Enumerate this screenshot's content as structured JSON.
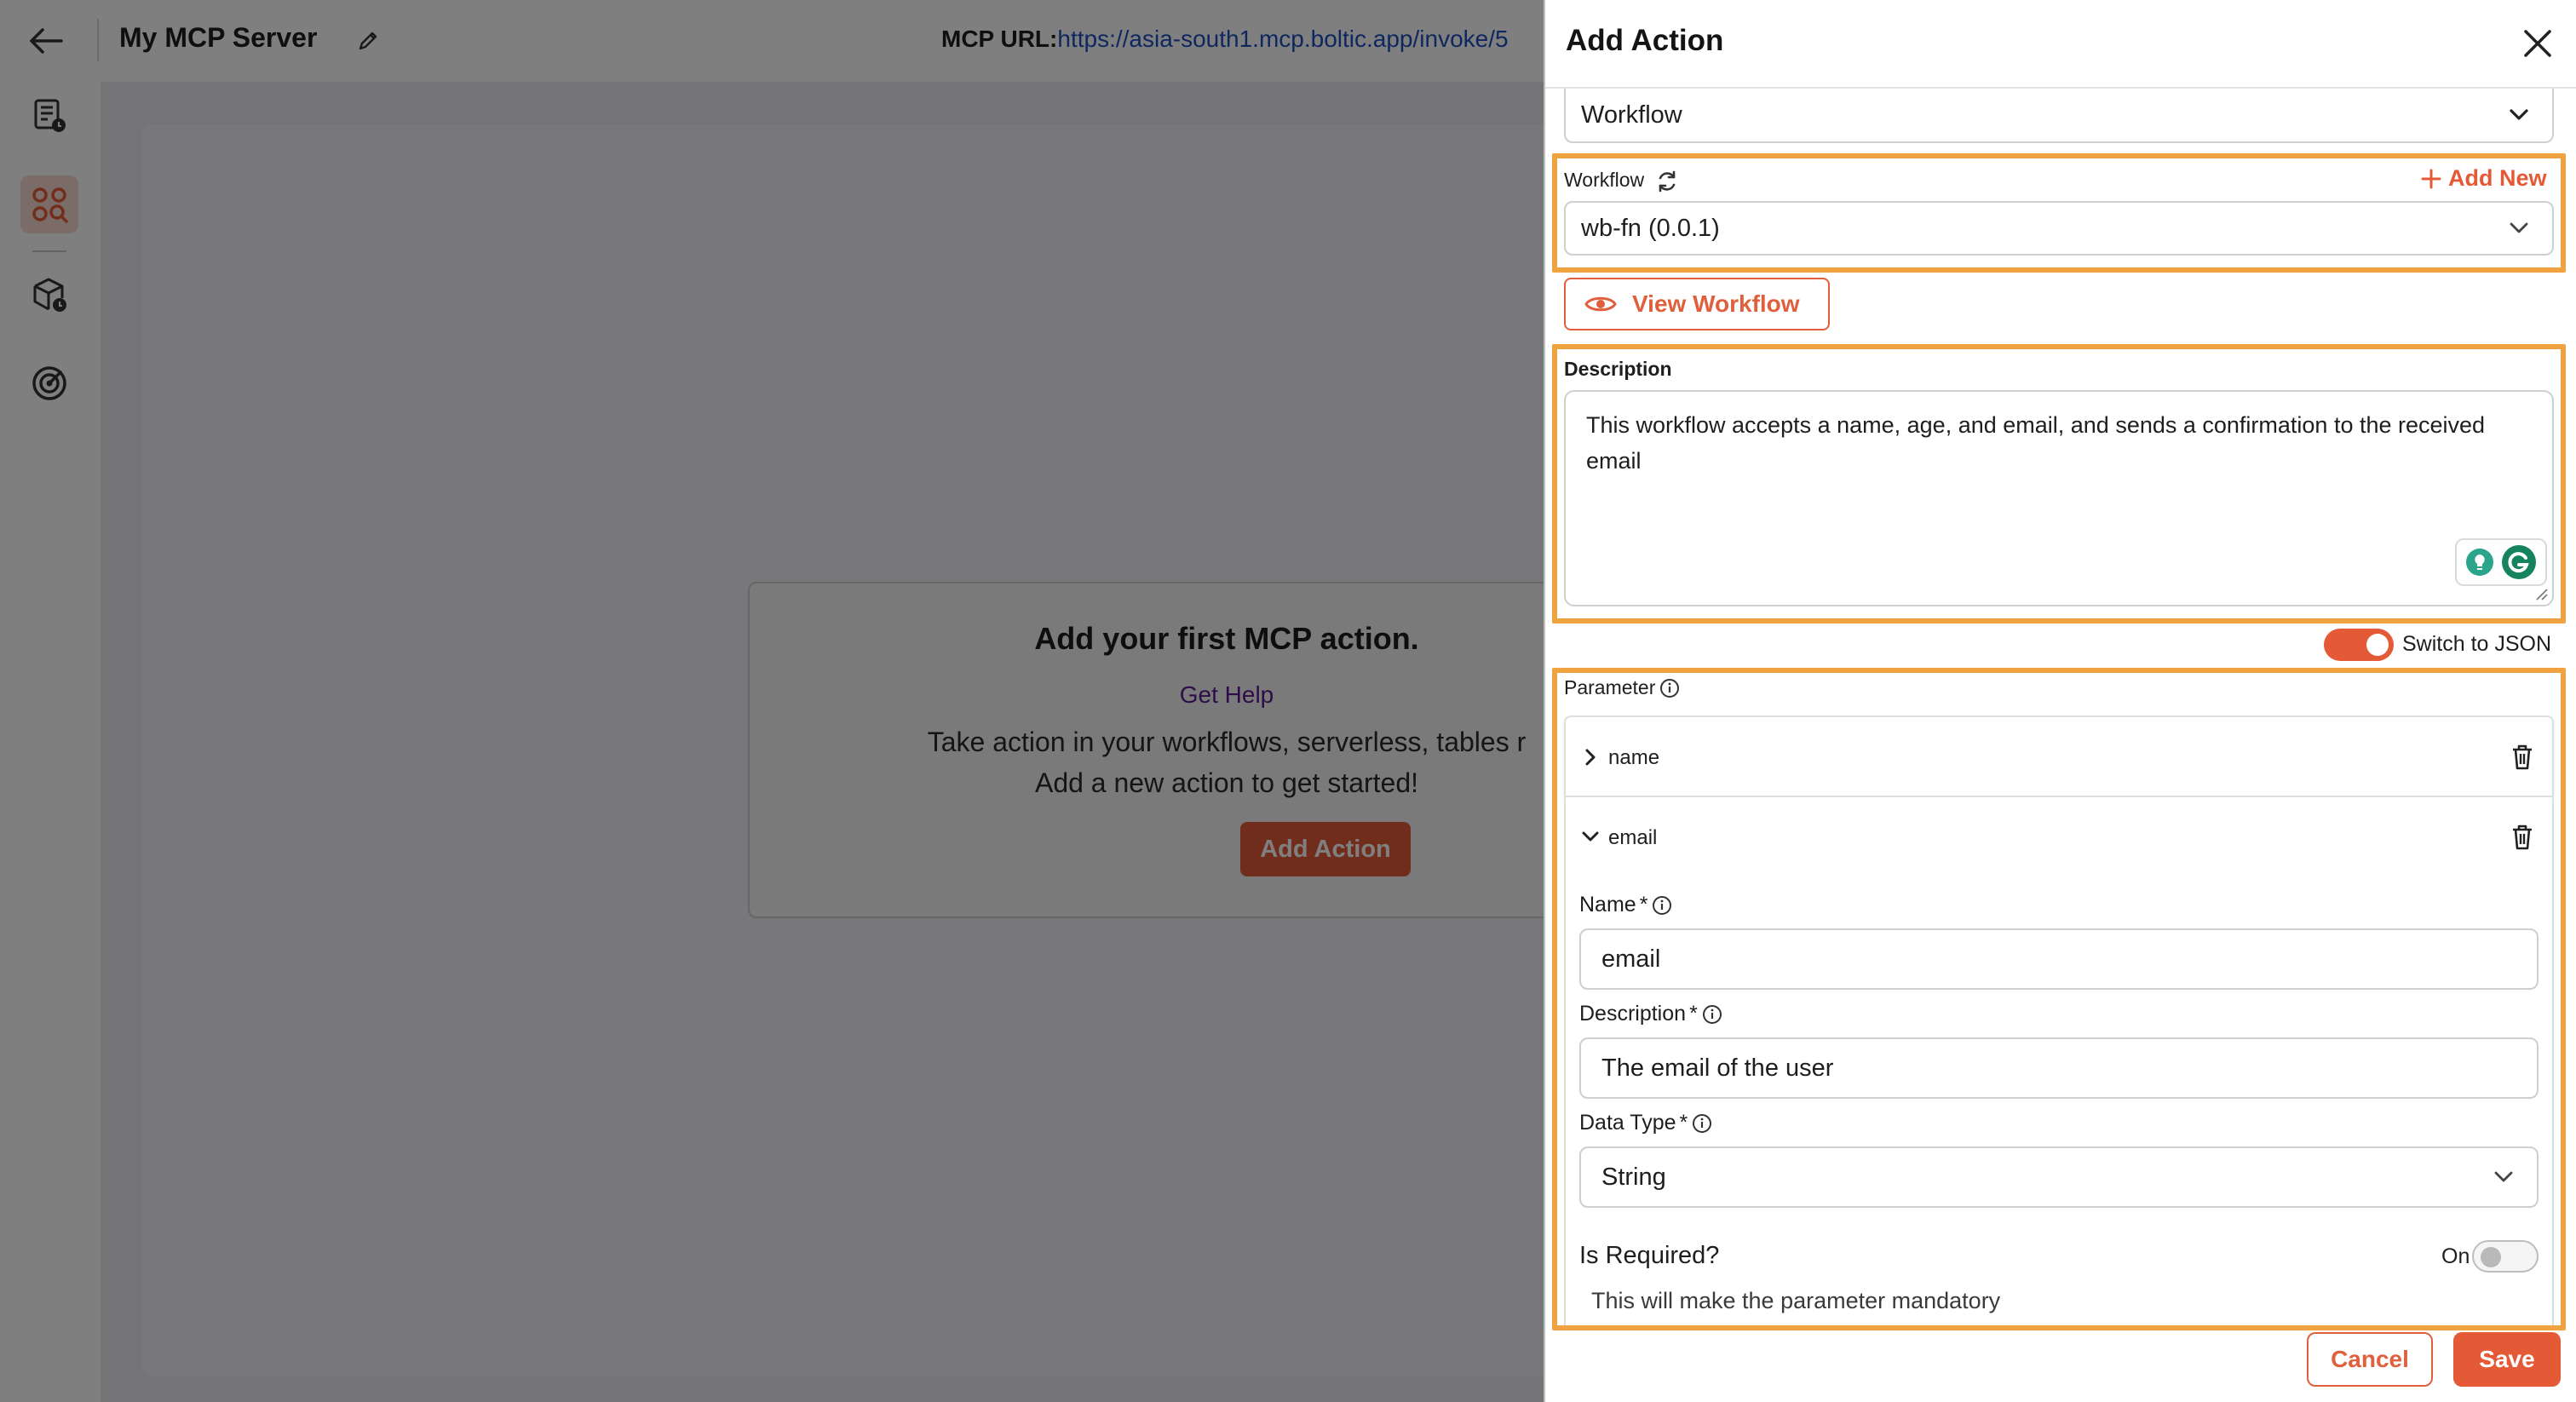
{
  "header": {
    "server_title": "My MCP Server",
    "mcp_url_label": "MCP URL:",
    "mcp_url_value": "https://asia-south1.mcp.boltic.app/invoke/5"
  },
  "sidebar": {
    "items": [
      {
        "icon": "document-clock-icon",
        "active": false
      },
      {
        "icon": "mcp-grid-search-icon",
        "active": true
      },
      {
        "icon": "cube-clock-icon",
        "active": false
      },
      {
        "icon": "radar-icon",
        "active": false
      }
    ]
  },
  "empty_state": {
    "title": "Add your first MCP action.",
    "help_link": "Get Help",
    "description_line1": "Take action in your workflows, serverless, tables r",
    "description_line2": "Add a new action to get started!",
    "button_label": "Add Action"
  },
  "drawer": {
    "title": "Add Action",
    "action_type": "Workflow",
    "workflow_label": "Workflow",
    "add_new_label": "Add New",
    "workflow_selected": "wb-fn (0.0.1)",
    "view_workflow_label": "View Workflow",
    "description_label": "Description",
    "description_text": "This workflow accepts a name, age, and email, and sends a confirmation to the received email",
    "switch_to_json_label": "Switch to JSON",
    "switch_to_json_on": true,
    "parameter_label": "Parameter",
    "parameters": [
      {
        "name": "name",
        "expanded": false
      },
      {
        "name": "email",
        "expanded": true
      }
    ],
    "param_form": {
      "name_label": "Name",
      "name_value": "email",
      "description_label": "Description",
      "description_value": "The email of the user",
      "data_type_label": "Data Type",
      "data_type_value": "String",
      "required_marker": "*",
      "is_required_label": "Is Required?",
      "is_required_state_label": "On",
      "is_required_on": false,
      "is_required_hint": "This will make the parameter mandatory"
    },
    "cancel_label": "Cancel",
    "save_label": "Save"
  },
  "colors": {
    "accent": "#e55a36",
    "highlight": "#f0a140",
    "link": "#1f4fbf",
    "help_link": "#5b1b8e"
  }
}
